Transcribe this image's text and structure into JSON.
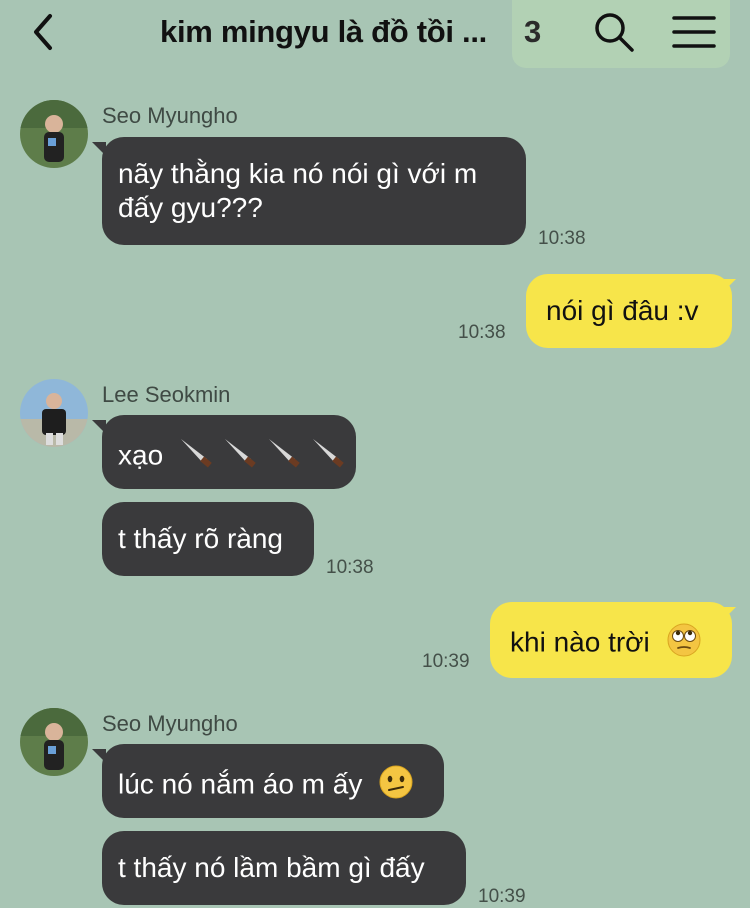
{
  "header": {
    "title": "kim mingyu là đồ tồi ...",
    "member_count": "3",
    "back_icon": "chevron-left-icon",
    "search_icon": "search-icon",
    "menu_icon": "hamburger-menu-icon"
  },
  "messages": [
    {
      "sender": "Seo Myungho",
      "text_line1": "nãy thằng kia nó nói gì với m",
      "text_line2": "đấy gyu???",
      "time": "10:38"
    },
    {
      "text": "nói gì đâu :v",
      "time": "10:38"
    },
    {
      "sender": "Lee Seokmin",
      "text": "xạo",
      "text2": "t thấy rõ ràng",
      "time": "10:38"
    },
    {
      "text": "khi nào trời",
      "time": "10:39"
    },
    {
      "sender": "Seo Myungho",
      "text": "lúc nó nắm áo m ấy",
      "text2": "t thấy nó lầm bầm gì đấy",
      "time": "10:39"
    }
  ],
  "colors": {
    "background": "#a8c5b4",
    "bubble_dark": "#3a3a3c",
    "bubble_mine": "#f7e54a"
  }
}
